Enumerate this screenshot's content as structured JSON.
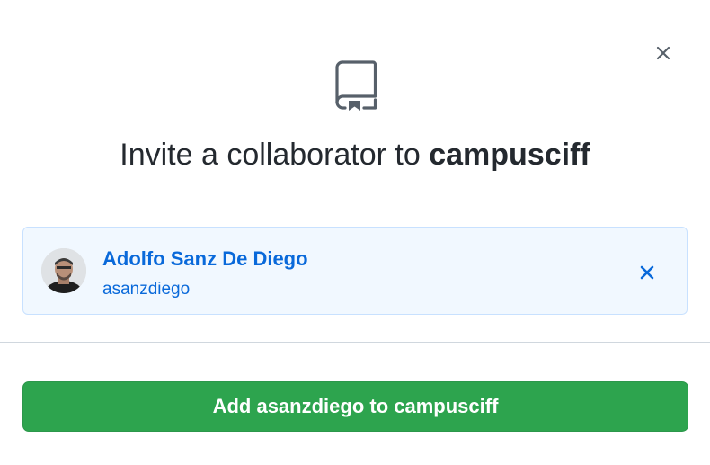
{
  "dialog": {
    "title_prefix": "Invite a collaborator to ",
    "repo_name": "campusciff",
    "close_icon": "close-icon",
    "header_icon": "repo-icon"
  },
  "selected_user": {
    "display_name": "Adolfo Sanz De Diego",
    "login": "asanzdiego",
    "remove_icon": "close-icon"
  },
  "actions": {
    "add_label": "Add asanzdiego to campusciff"
  },
  "colors": {
    "accent_blue": "#0969da",
    "card_background": "#f1f8ff",
    "card_border": "#c8e1ff",
    "button_green": "#2da44e",
    "icon_gray": "#57606a"
  }
}
